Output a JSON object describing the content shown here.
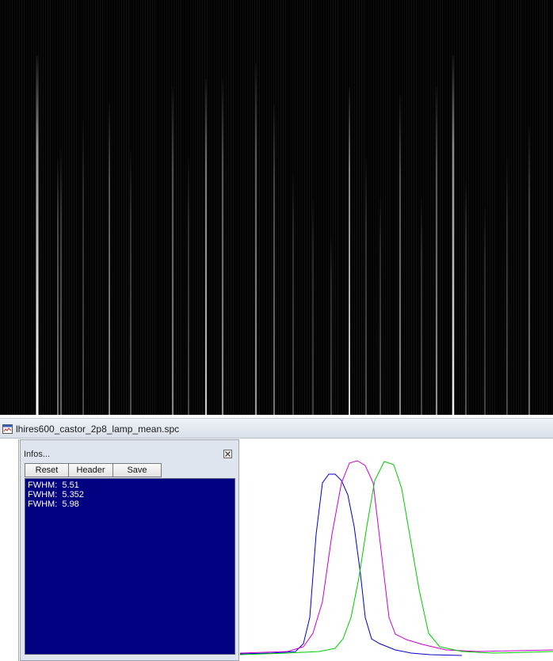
{
  "window": {
    "title": "lhires600_castor_2p8_lamp_mean.spc"
  },
  "infos_panel": {
    "title": "Infos...",
    "buttons": {
      "reset": "Reset",
      "header": "Header",
      "save": "Save"
    },
    "results": [
      {
        "label": "FWHM:",
        "value": "5.51"
      },
      {
        "label": "FWHM:",
        "value": "5.352"
      },
      {
        "label": "FWHM:",
        "value": "5.98"
      }
    ]
  },
  "profile_plot": {
    "series_colors": [
      "#0000cc",
      "#cc00cc",
      "#00cc00"
    ]
  },
  "colors": {
    "results_background": "#000080",
    "spectrum_background": "#030303"
  },
  "icons": {
    "window": "document-spectrum-icon",
    "close": "close-icon"
  }
}
